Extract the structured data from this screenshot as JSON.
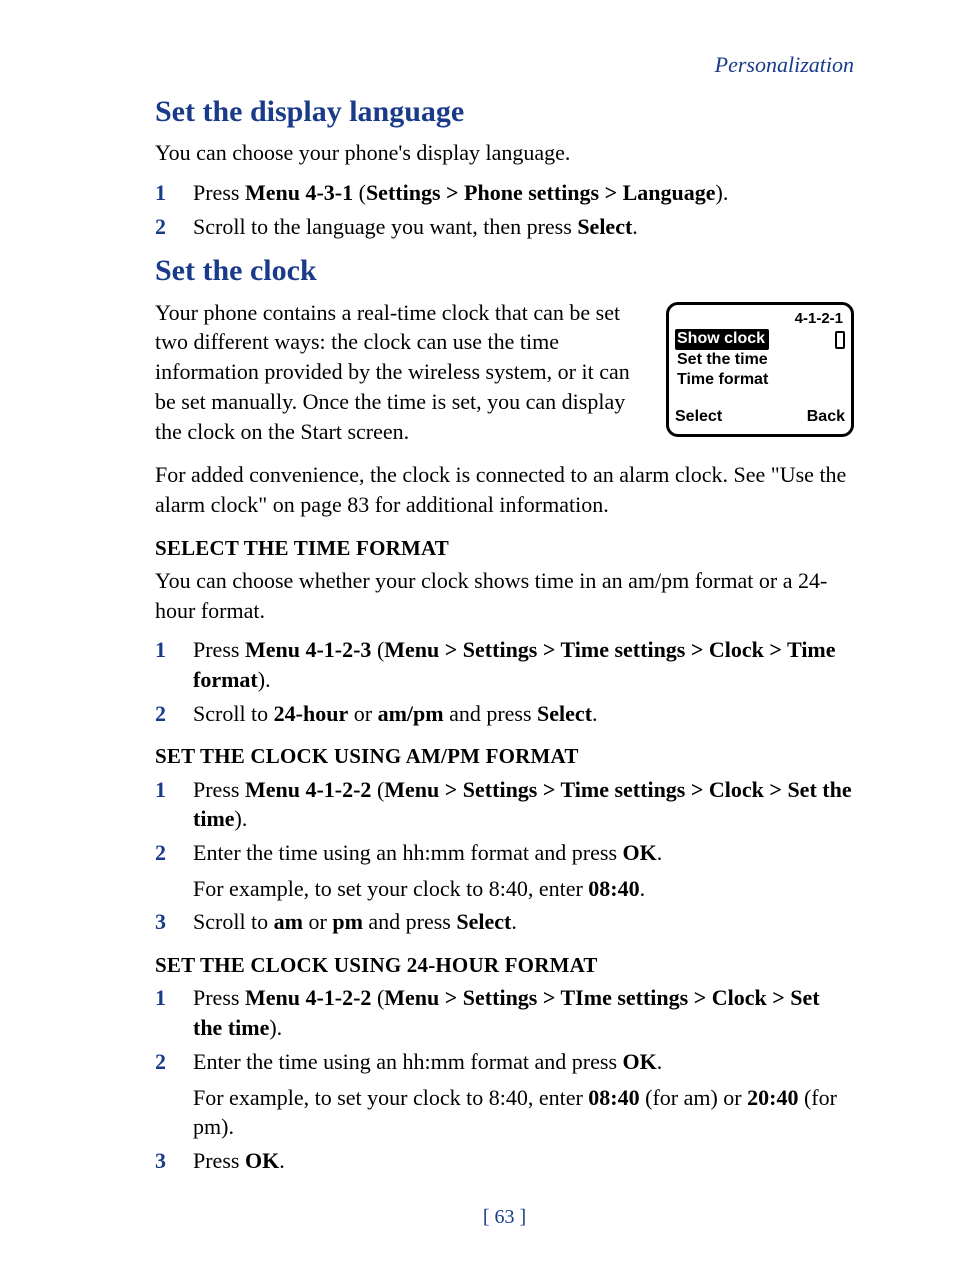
{
  "header": {
    "section": "Personalization"
  },
  "page_number": "[ 63 ]",
  "s1": {
    "title": "Set the display language",
    "intro": "You can choose your phone's display language.",
    "steps": [
      {
        "n": "1",
        "pre": "Press ",
        "bold": "Menu 4-3-1",
        "mid": " (",
        "path": "Settings > Phone settings > Language",
        "post": ")."
      },
      {
        "n": "2",
        "pre": "Scroll to the language you want, then press ",
        "bold": "Select",
        "post": "."
      }
    ]
  },
  "s2": {
    "title": "Set the clock",
    "para1": "Your phone contains a real-time clock that can be set two different ways: the clock can use the time information provided by the wireless system, or it can be set manually. Once the time is set, you can display the clock on the Start screen.",
    "para2": "For added convenience, the clock is connected to an alarm clock. See \"Use the alarm clock\" on page 83 for additional information."
  },
  "screen": {
    "code": "4-1-2-1",
    "item1": "Show clock",
    "item2": "Set the time",
    "item3": "Time format",
    "sk_left": "Select",
    "sk_right": "Back"
  },
  "tf": {
    "title": "SELECT THE TIME FORMAT",
    "intro": "You can choose whether your clock shows time in an am/pm format or a 24-hour format.",
    "step1_menu": "Menu 4-1-2-3",
    "step1_path": "Menu > Settings > Time settings > Clock > Time format",
    "step2_a": "24-hour",
    "step2_b": "am/pm",
    "step2_sel": "Select"
  },
  "ampm": {
    "title": "SET THE CLOCK USING AM/PM FORMAT",
    "step1_menu": "Menu 4-1-2-2",
    "step1_path": "Menu > Settings > Time settings > Clock > Set the time",
    "step2_text": "Enter the time using an hh:mm format and press ",
    "step2_ok": "OK",
    "step2_eg_pre": "For example, to set your clock to 8:40, enter ",
    "step2_eg_val": "08:40",
    "step3_a": "am",
    "step3_b": "pm",
    "step3_sel": "Select"
  },
  "h24": {
    "title": "SET THE CLOCK USING 24-HOUR FORMAT",
    "step1_menu": "Menu 4-1-2-2",
    "step1_path": "Menu > Settings > TIme settings > Clock > Set the time",
    "step2_text": "Enter the time using an hh:mm format and press ",
    "step2_ok": "OK",
    "step2_eg_pre": "For example, to set your clock to 8:40, enter ",
    "step2_eg_v1": "08:40",
    "step2_eg_mid": " (for am) or ",
    "step2_eg_v2": "20:40",
    "step2_eg_post": " (for pm).",
    "step3_pre": "Press ",
    "step3_ok": "OK"
  }
}
